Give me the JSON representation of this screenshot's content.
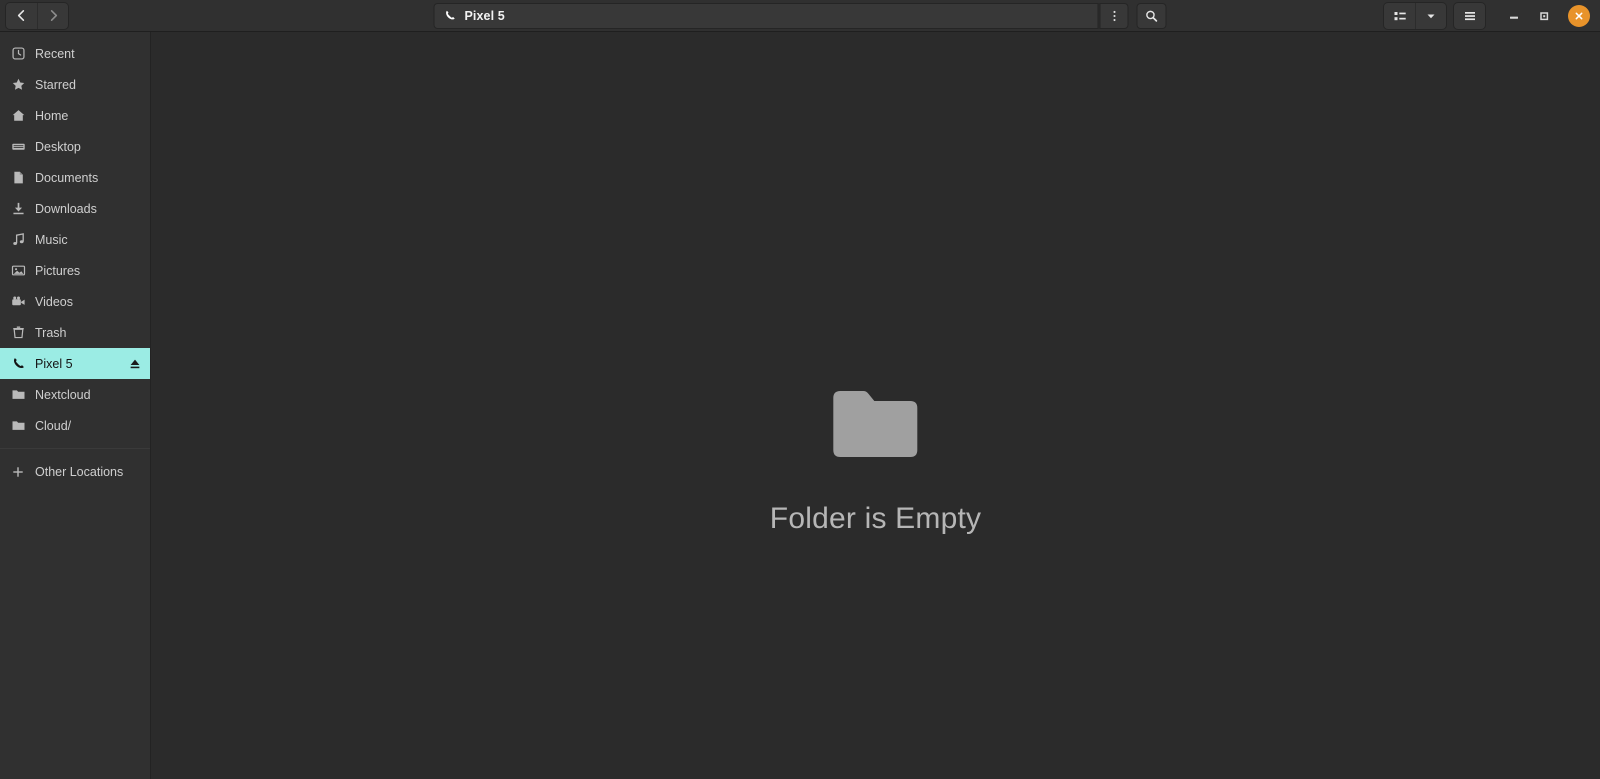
{
  "window": {
    "title": "Pixel 5",
    "controls": {
      "minimize": "minimize",
      "maximize": "maximize",
      "close": "close",
      "close_color": "#e8932a"
    }
  },
  "header": {
    "back_label": "Back",
    "forward_label": "Forward",
    "pathbar": {
      "current_location": "Pixel 5",
      "location_icon": "phone-icon",
      "menu_label": "Location options"
    },
    "search_label": "Search",
    "view_toggle_label": "List view",
    "view_dropdown_label": "View options",
    "main_menu_label": "Main menu"
  },
  "sidebar": {
    "items": [
      {
        "label": "Recent",
        "icon": "clock-icon",
        "selected": false,
        "eject": false
      },
      {
        "label": "Starred",
        "icon": "star-icon",
        "selected": false,
        "eject": false
      },
      {
        "label": "Home",
        "icon": "home-icon",
        "selected": false,
        "eject": false
      },
      {
        "label": "Desktop",
        "icon": "desktop-icon",
        "selected": false,
        "eject": false
      },
      {
        "label": "Documents",
        "icon": "document-icon",
        "selected": false,
        "eject": false
      },
      {
        "label": "Downloads",
        "icon": "download-icon",
        "selected": false,
        "eject": false
      },
      {
        "label": "Music",
        "icon": "music-icon",
        "selected": false,
        "eject": false
      },
      {
        "label": "Pictures",
        "icon": "picture-icon",
        "selected": false,
        "eject": false
      },
      {
        "label": "Videos",
        "icon": "video-icon",
        "selected": false,
        "eject": false
      },
      {
        "label": "Trash",
        "icon": "trash-icon",
        "selected": false,
        "eject": false
      },
      {
        "label": "Pixel 5",
        "icon": "phone-icon",
        "selected": true,
        "eject": true
      },
      {
        "label": "Nextcloud",
        "icon": "folder-icon",
        "selected": false,
        "eject": false
      },
      {
        "label": "Cloud/",
        "icon": "folder-icon",
        "selected": false,
        "eject": false
      }
    ],
    "other_locations": {
      "label": "Other Locations",
      "icon": "plus-icon"
    },
    "selected_color": "#9bece4"
  },
  "main": {
    "empty_state": {
      "icon": "folder-icon",
      "message": "Folder is Empty"
    }
  }
}
